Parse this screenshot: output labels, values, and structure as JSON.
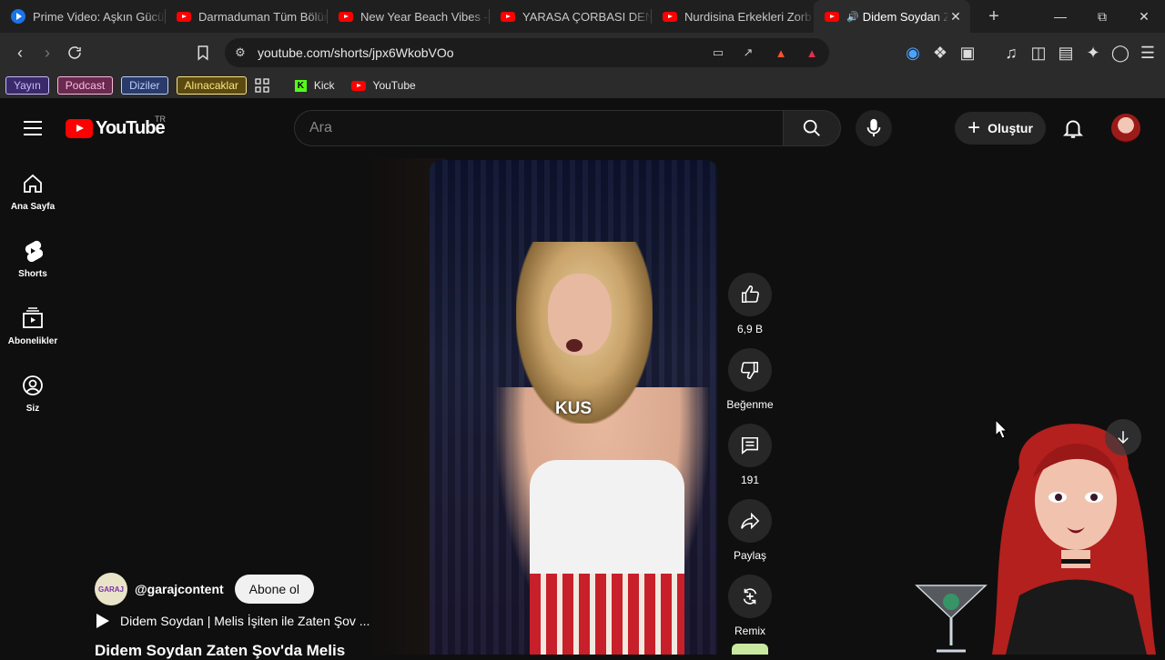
{
  "browser": {
    "tabs": [
      {
        "title": "Prime Video: Aşkın Gücü",
        "icon": "prime-video-icon"
      },
      {
        "title": "Darmaduman Tüm Bölüm",
        "icon": "youtube-icon"
      },
      {
        "title": "New Year Beach Vibes -",
        "icon": "youtube-icon"
      },
      {
        "title": "YARASA ÇORBASI DENİY",
        "icon": "youtube-icon"
      },
      {
        "title": "Nurdisina Erkekleri Zorb",
        "icon": "youtube-icon"
      },
      {
        "title": "Didem Soydan Z",
        "icon": "youtube-icon",
        "active": true
      }
    ],
    "url": "youtube.com/shorts/jpx6WkobVOo",
    "bookmarks": {
      "chips": [
        {
          "label": "Yayın",
          "bg": "#3a2a6a",
          "fg": "#c9b8ff"
        },
        {
          "label": "Podcast",
          "bg": "#6a2a50",
          "fg": "#ffb8e0"
        },
        {
          "label": "Diziler",
          "bg": "#2a3a6a",
          "fg": "#b8d0ff"
        },
        {
          "label": "Alınacaklar",
          "bg": "#5a4a10",
          "fg": "#ffe680"
        }
      ],
      "kick": "Kick",
      "youtube": "YouTube"
    }
  },
  "youtube": {
    "logo_text": "YouTube",
    "region": "TR",
    "search_placeholder": "Ara",
    "create_label": "Oluştur",
    "sidebar": [
      {
        "label": "Ana Sayfa"
      },
      {
        "label": "Shorts"
      },
      {
        "label": "Abonelikler"
      },
      {
        "label": "Siz"
      }
    ],
    "short": {
      "caption": "KUS",
      "like_count": "6,9 B",
      "dislike_label": "Beğenme",
      "comment_count": "191",
      "share_label": "Paylaş",
      "remix_label": "Remix",
      "channel_avatar_text": "GARAJ",
      "channel_handle": "@garajcontent",
      "subscribe_label": "Abone ol",
      "linked_video": "Didem Soydan | Melis İşiten ile Zaten Şov ...",
      "title": "Didem Soydan Zaten Şov'da Melis"
    }
  },
  "colors": {
    "youtube_red": "#ff0000",
    "background": "#0f0f0f",
    "browser_chrome": "#2b2b2b"
  }
}
